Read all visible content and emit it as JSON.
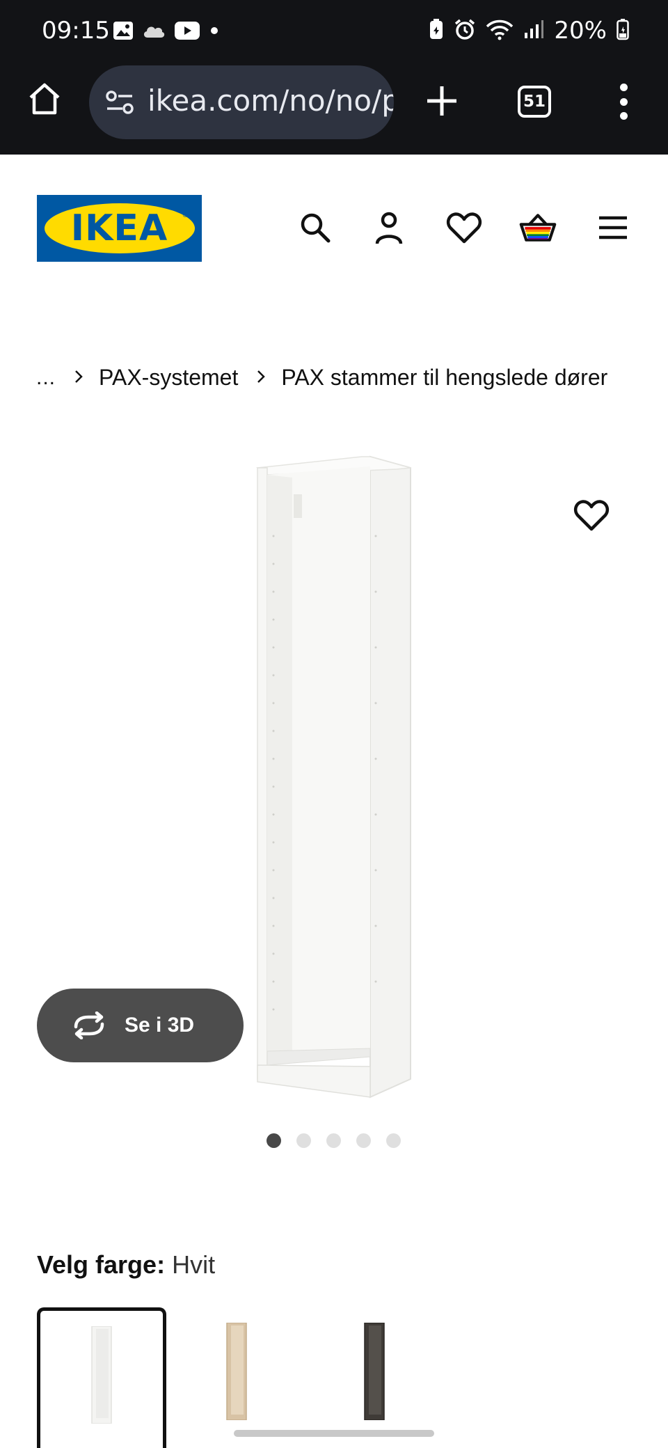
{
  "status_bar": {
    "time": "09:15",
    "battery_percent": "20%"
  },
  "browser": {
    "url": "ikea.com/no/no/p",
    "tab_count": "51"
  },
  "header": {
    "logo_text": "IKEA"
  },
  "breadcrumb": {
    "ellipsis": "...",
    "items": [
      "PAX-systemet",
      "PAX stammer til hengslede dører"
    ]
  },
  "gallery": {
    "see_3d_label": "Se i 3D",
    "image_count": 5,
    "active_index": 0
  },
  "color_picker": {
    "label": "Velg farge:",
    "selected_value": "Hvit",
    "options": [
      {
        "name": "white",
        "color": "#f4f4f2"
      },
      {
        "name": "white-stained-oak",
        "color": "#d8c3a5"
      },
      {
        "name": "black-brown",
        "color": "#3f3b37"
      }
    ]
  },
  "colors": {
    "ikea_blue": "#0058a3",
    "ikea_yellow": "#ffdb00",
    "chrome_bg": "#121316"
  }
}
